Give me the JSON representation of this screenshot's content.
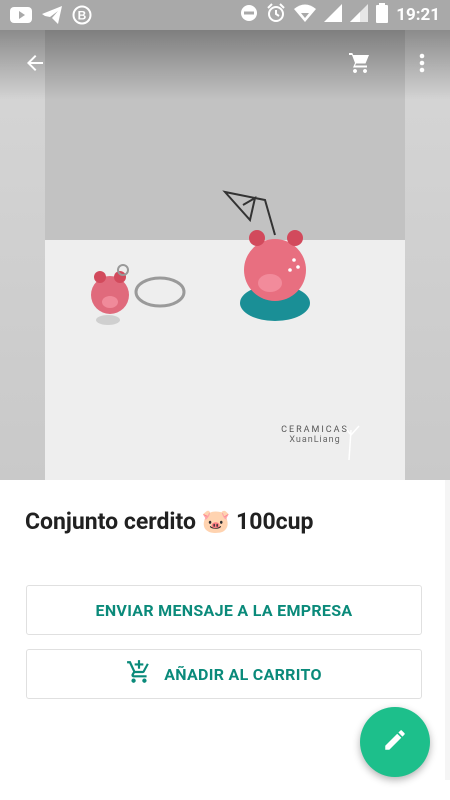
{
  "status_bar": {
    "time": "19:21",
    "icons_left": [
      "youtube-icon",
      "telegram-icon",
      "bitcoin-icon"
    ],
    "icons_right": [
      "do-not-disturb-icon",
      "alarm-icon",
      "wifi-icon",
      "signal-icon",
      "signal-icon",
      "battery-icon"
    ]
  },
  "app_bar": {
    "back_icon": "arrow-left-icon",
    "cart_icon": "cart-icon",
    "menu_icon": "more-vertical-icon"
  },
  "product": {
    "image_watermark": "CERAMICAS",
    "image_watermark_sub": "XuanLiang",
    "title": "Conjunto cerdito 🐷 100cup"
  },
  "actions": {
    "message_button": "ENVIAR MENSAJE A LA EMPRESA",
    "add_cart_button": "AÑADIR AL CARRITO",
    "add_cart_icon": "add-shopping-cart-icon"
  },
  "fab": {
    "icon": "pencil-icon"
  },
  "colors": {
    "accent": "#0a8a7a",
    "fab": "#1dbf8b",
    "status_bar": "#a9a9a9"
  }
}
